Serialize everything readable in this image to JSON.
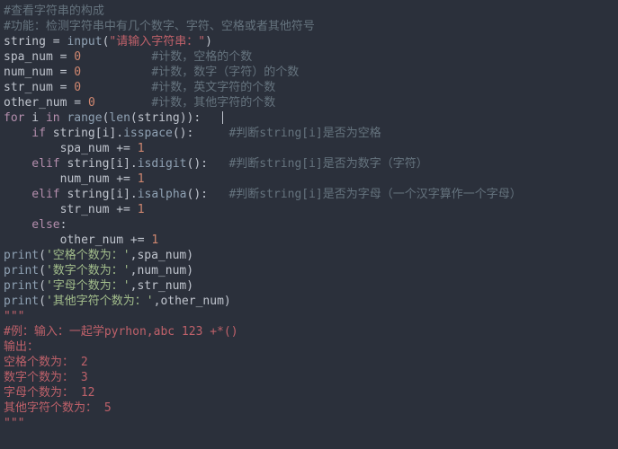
{
  "lines": {
    "l1": "#查看字符串的构成",
    "l2": "#功能：检测字符串中有几个数字、字符、空格或者其他符号",
    "l3a": "string",
    "l3b": " = ",
    "l3c": "input",
    "l3d": "(",
    "l3e": "\"请输入字符串：\"",
    "l3f": ")",
    "l4a": "spa_num",
    "l4b": " = ",
    "l4c": "0",
    "l4d": "          #计数，空格的个数",
    "l5a": "num_num",
    "l5b": " = ",
    "l5c": "0",
    "l5d": "          #计数，数字（字符）的个数",
    "l6a": "str_num",
    "l6b": " = ",
    "l6c": "0",
    "l6d": "          #计数，英文字符的个数",
    "l7a": "other_num",
    "l7b": " = ",
    "l7c": "0",
    "l7d": "        #计数，其他字符的个数",
    "l8a": "for",
    "l8b": " i ",
    "l8c": "in",
    "l8d": " ",
    "l8e": "range",
    "l8f": "(",
    "l8g": "len",
    "l8h": "(string)):   ",
    "l9a": "    if",
    "l9b": " string[i].",
    "l9c": "isspace",
    "l9d": "():     ",
    "l9e": "#判断string[i]是否为空格",
    "l10a": "        spa_num += ",
    "l10b": "1",
    "l11a": "    elif",
    "l11b": " string[i].",
    "l11c": "isdigit",
    "l11d": "():   ",
    "l11e": "#判断string[i]是否为数字（字符）",
    "l12a": "        num_num += ",
    "l12b": "1",
    "l13a": "    elif",
    "l13b": " string[i].",
    "l13c": "isalpha",
    "l13d": "():   ",
    "l13e": "#判断string[i]是否为字母（一个汉字算作一个字母）",
    "l14a": "        str_num += ",
    "l14b": "1",
    "l15a": "    else",
    "l15b": ":",
    "l16a": "        other_num += ",
    "l16b": "1",
    "l17a": "print",
    "l17b": "(",
    "l17c": "'空格个数为：'",
    "l17d": ",spa_num)",
    "l18a": "print",
    "l18b": "(",
    "l18c": "'数字个数为：'",
    "l18d": ",num_num)",
    "l19a": "print",
    "l19b": "(",
    "l19c": "'字母个数为：'",
    "l19d": ",str_num)",
    "l20a": "print",
    "l20b": "(",
    "l20c": "'其他字符个数为：'",
    "l20d": ",other_num)",
    "l21": "\"\"\"",
    "l22": "#例：输入：一起学pyrhon,abc 123 +*()",
    "l23": "输出：",
    "l24": "空格个数为： 2",
    "l25": "数字个数为： 3",
    "l26": "字母个数为： 12",
    "l27": "其他字符个数为： 5",
    "l28": "\"\"\""
  }
}
